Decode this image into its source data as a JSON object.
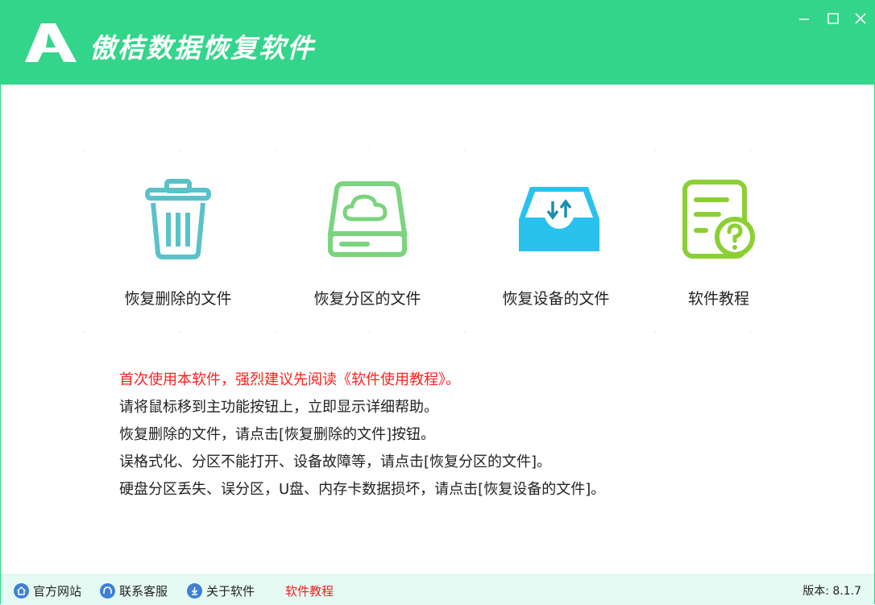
{
  "app": {
    "title": "傲桔数据恢复软件",
    "logo_icon": "letter-a-logo",
    "brand_color": "#33d58a"
  },
  "window_controls": {
    "minimize": "minimize-icon",
    "maximize": "maximize-icon",
    "close": "close-icon"
  },
  "features": [
    {
      "label": "恢复删除的文件",
      "icon": "trash-icon",
      "color": "#5ac1c9"
    },
    {
      "label": "恢复分区的文件",
      "icon": "cloud-drive-icon",
      "color": "#7bd47f"
    },
    {
      "label": "恢复设备的文件",
      "icon": "device-transfer-icon",
      "color": "#29c2ee"
    },
    {
      "label": "软件教程",
      "icon": "document-help-icon",
      "color": "#8ccf34"
    }
  ],
  "tips": [
    "首次使用本软件，强烈建议先阅读《软件使用教程》。",
    "请将鼠标移到主功能按钮上，立即显示详细帮助。",
    "恢复删除的文件，请点击[恢复删除的文件]按钮。",
    "误格式化、分区不能打开、设备故障等，请点击[恢复分区的文件]。",
    "硬盘分区丢失、误分区，U盘、内存卡数据损坏，请点击[恢复设备的文件]。"
  ],
  "statusbar": {
    "site": "官方网站",
    "service": "联系客服",
    "about": "关于软件",
    "tutorial": "软件教程",
    "version": "版本: 8.1.7"
  }
}
